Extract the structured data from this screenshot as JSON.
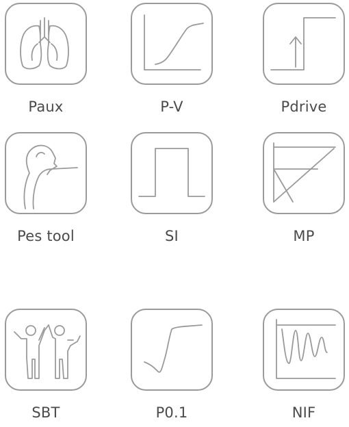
{
  "tools": [
    {
      "label": "Paux",
      "icon": "lungs-icon"
    },
    {
      "label": "P-V",
      "icon": "pressure-volume-curve-icon"
    },
    {
      "label": "Pdrive",
      "icon": "pressure-step-icon"
    },
    {
      "label": "Pes tool",
      "icon": "esophageal-head-icon"
    },
    {
      "label": "SI",
      "icon": "square-pulse-icon"
    },
    {
      "label": "MP",
      "icon": "mechanical-power-icon"
    },
    {
      "label": "SBT",
      "icon": "people-cheering-icon"
    },
    {
      "label": "P0.1",
      "icon": "occlusion-pressure-icon"
    },
    {
      "label": "NIF",
      "icon": "oscillation-icon"
    }
  ],
  "colors": {
    "icon_stroke": "#9a9a9a",
    "label_text": "#4a4a4a",
    "background": "#ffffff"
  }
}
